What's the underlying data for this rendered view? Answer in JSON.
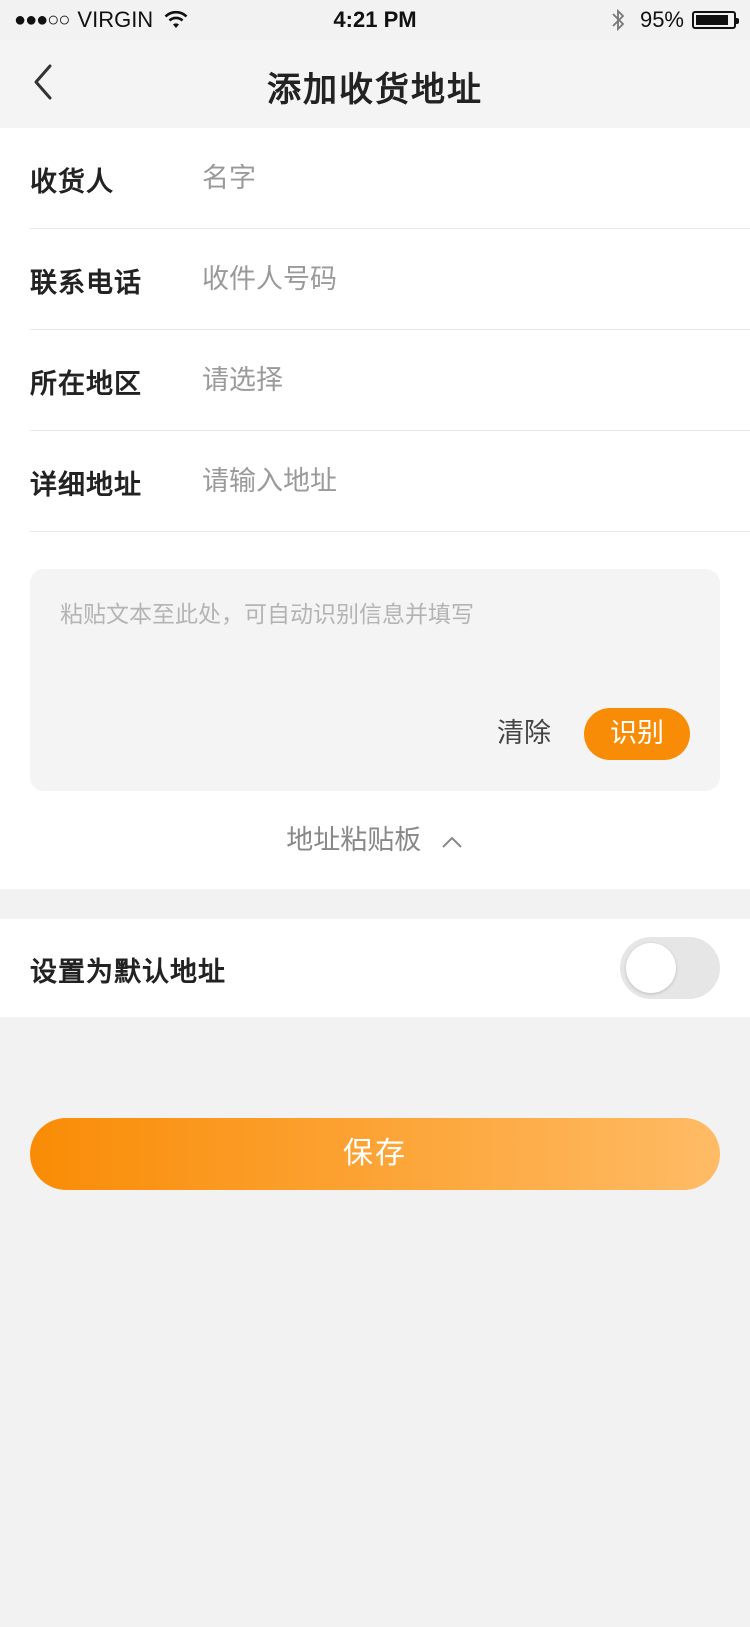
{
  "status_bar": {
    "signal": "●●●○○",
    "carrier": "VIRGIN",
    "time": "4:21 PM",
    "battery_percent": "95%",
    "battery_level": 0.95
  },
  "nav": {
    "title": "添加收货地址",
    "back_icon": "chevron-left-icon"
  },
  "form": {
    "recipient": {
      "label": "收货人",
      "placeholder": "名字",
      "value": ""
    },
    "phone": {
      "label": "联系电话",
      "placeholder": "收件人号码",
      "value": ""
    },
    "region": {
      "label": "所在地区",
      "placeholder": "请选择",
      "value": ""
    },
    "address": {
      "label": "详细地址",
      "placeholder": "请输入地址",
      "value": ""
    }
  },
  "paste": {
    "placeholder": "粘贴文本至此处，可自动识别信息并填写",
    "value": "",
    "clear_label": "清除",
    "recognize_label": "识别",
    "clipboard_label": "地址粘贴板"
  },
  "default_address": {
    "label": "设置为默认地址",
    "enabled": false
  },
  "save_label": "保存",
  "colors": {
    "accent": "#f98c06",
    "accent_light": "#ffbb65",
    "background": "#f2f2f2",
    "placeholder": "#9a9a9a"
  }
}
